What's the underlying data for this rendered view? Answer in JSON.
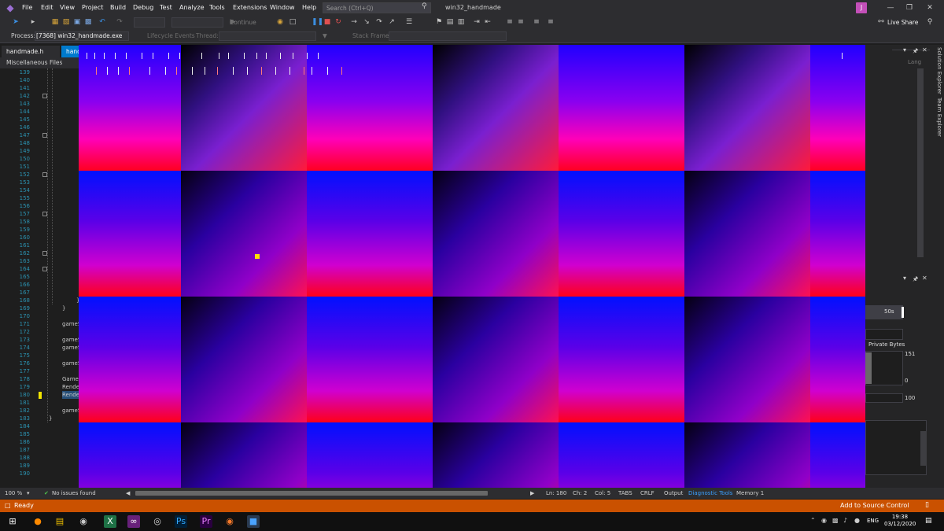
{
  "menu": {
    "items": [
      "File",
      "Edit",
      "View",
      "Project",
      "Build",
      "Debug",
      "Test",
      "Analyze",
      "Tools",
      "Extensions",
      "Window",
      "Help"
    ],
    "search_placeholder": "Search (Ctrl+Q)",
    "window_title": "win32_handmade",
    "avatar_initial": "J"
  },
  "toolbar": {
    "continue_label": "Continue",
    "liveshare_label": "Live Share"
  },
  "debugbar": {
    "process_label": "Process:",
    "process_value": "[7368] win32_handmade.exe",
    "lifecycle_label": "Lifecycle Events",
    "thread_label": "Thread:",
    "stackframe_label": "Stack Frame:"
  },
  "tabs": {
    "tab1": "handmade.h",
    "tab2": "handm"
  },
  "navbar": {
    "label": "Miscellaneous Files"
  },
  "editor": {
    "line_numbers": [
      "139",
      "140",
      "141",
      "142",
      "143",
      "144",
      "145",
      "146",
      "147",
      "148",
      "149",
      "150",
      "151",
      "152",
      "153",
      "154",
      "155",
      "156",
      "157",
      "158",
      "159",
      "160",
      "161",
      "162",
      "163",
      "164",
      "165",
      "166",
      "167",
      "168",
      "169",
      "170",
      "171",
      "172",
      "173",
      "174",
      "175",
      "176",
      "177",
      "178",
      "179",
      "180",
      "181",
      "182",
      "183",
      "184",
      "185",
      "186",
      "187",
      "188",
      "189",
      "190"
    ],
    "code_lines": [
      {
        "line": "168",
        "text": "}"
      },
      {
        "line": "169",
        "text": "}"
      },
      {
        "line": "171",
        "text": "gameS"
      },
      {
        "line": "173",
        "text": "gameS"
      },
      {
        "line": "174",
        "text": "gameS"
      },
      {
        "line": "176",
        "text": "gameS"
      },
      {
        "line": "178",
        "text": "GameO"
      },
      {
        "line": "179",
        "text": "Rende"
      },
      {
        "line": "180",
        "text": "Rende"
      },
      {
        "line": "182",
        "text": "gameS"
      },
      {
        "line": "183",
        "text": "}"
      }
    ]
  },
  "right_panel": {
    "solution_explorer": "Solution Explorer",
    "team_explorer": "Team Explorer",
    "lang_label": "Lang",
    "diag_time": "50s",
    "private_bytes": "Private Bytes",
    "value_151": "151",
    "value_0": "0",
    "value_100": "100"
  },
  "bottom": {
    "zoom": "100 %",
    "issues": "No issues found",
    "ln": "Ln: 180",
    "ch": "Ch: 2",
    "col": "Col: 5",
    "tabs": "TABS",
    "crlf": "CRLF",
    "tab_output": "Output",
    "tab_diag": "Diagnostic Tools",
    "tab_memory": "Memory 1"
  },
  "status": {
    "ready": "Ready",
    "add_source": "Add to Source Control"
  },
  "taskbar": {
    "lang": "ENG",
    "time": "19:38",
    "date": "03/12/2020"
  },
  "colors": {
    "accent": "#007acc",
    "status_bar": "#ca5100",
    "player": "#ffe000"
  }
}
